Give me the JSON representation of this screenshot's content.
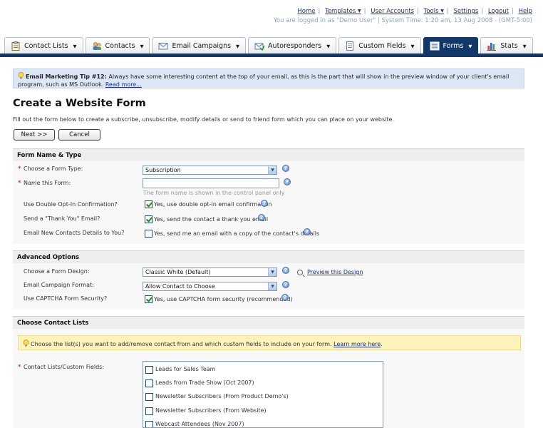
{
  "header": {
    "links": [
      {
        "label": "Home",
        "caret": false
      },
      {
        "label": "Templates",
        "caret": true
      },
      {
        "label": "User Accounts",
        "caret": false
      },
      {
        "label": "Tools",
        "caret": true
      },
      {
        "label": "Settings",
        "caret": false
      },
      {
        "label": "Logout",
        "caret": false
      },
      {
        "label": "Help",
        "caret": false
      }
    ],
    "status": "You are logged in as \"Demo User\" | System Time: 1:20 am, 13 Aug 2008 - (GMT-5:00)"
  },
  "tabs": [
    {
      "label": "Contact Lists",
      "icon": "clipboard-icon",
      "active": false
    },
    {
      "label": "Contacts",
      "icon": "contacts-icon",
      "active": false
    },
    {
      "label": "Email Campaigns",
      "icon": "envelope-icon",
      "active": false
    },
    {
      "label": "Autoresponders",
      "icon": "autoresponder-icon",
      "active": false
    },
    {
      "label": "Custom Fields",
      "icon": "document-icon",
      "active": false
    },
    {
      "label": "Forms",
      "icon": "form-icon",
      "active": true
    },
    {
      "label": "Stats",
      "icon": "bar-chart-icon",
      "active": false
    }
  ],
  "tip": {
    "title": "Email Marketing Tip #12:",
    "text": "Always have some interesting content at the top of your email, as this is the part that will show in the preview window of your client's email program, such as MS Outlook.",
    "link": "Read more..."
  },
  "page": {
    "title": "Create a Website Form",
    "intro": "Fill out the form below to create a subscribe, unsubscribe, modify details or send to friend form which you can place on your website.",
    "next_button": "Next >>",
    "cancel_button": "Cancel"
  },
  "form_name_type": {
    "heading": "Form Name & Type",
    "form_type_label": "Choose a Form Type:",
    "form_type_value": "Subscription",
    "name_label": "Name this Form:",
    "name_value": "",
    "name_hint": "The form name is shown in the control panel only",
    "double_optin_label": "Use Double Opt-In Confirmation?",
    "double_optin_text": "Yes, use double opt-in email confirmation",
    "double_optin_checked": true,
    "thankyou_label": "Send a \"Thank You\" Email?",
    "thankyou_text": "Yes, send the contact a thank you email",
    "thankyou_checked": true,
    "notify_label": "Email New Contacts Details to You?",
    "notify_text": "Yes, send me an email with a copy of the contact's details",
    "notify_checked": false
  },
  "advanced": {
    "heading": "Advanced Options",
    "design_label": "Choose a Form Design:",
    "design_value": "Classic White (Default)",
    "preview_link": "Preview this Design",
    "format_label": "Email Campaign Format:",
    "format_value": "Allow Contact to Choose",
    "captcha_label": "Use CAPTCHA Form Security?",
    "captcha_text": "Yes, use CAPTCHA form security (recommended)",
    "captcha_checked": true
  },
  "contact_lists": {
    "heading": "Choose Contact Lists",
    "info_text": "Choose the list(s) you want to add/remove contact from and which custom fields to include on your form.",
    "info_link": "Learn more here",
    "info_suffix": ".",
    "field_label": "Contact Lists/Custom Fields:",
    "items": [
      "Leads for Sales Team",
      "Leads from Trade Show (Oct 2007)",
      "Newsletter Subscribers (From Product Demo's)",
      "Newsletter Subscribers (From Website)",
      "Webcast Attendees (Nov 2007)"
    ]
  },
  "colors": {
    "nav_dark": "#12376a",
    "tip_bg": "#dce6f4",
    "info_bg": "#fbf3ba",
    "link": "#1a2f85",
    "required": "#cc0000"
  }
}
